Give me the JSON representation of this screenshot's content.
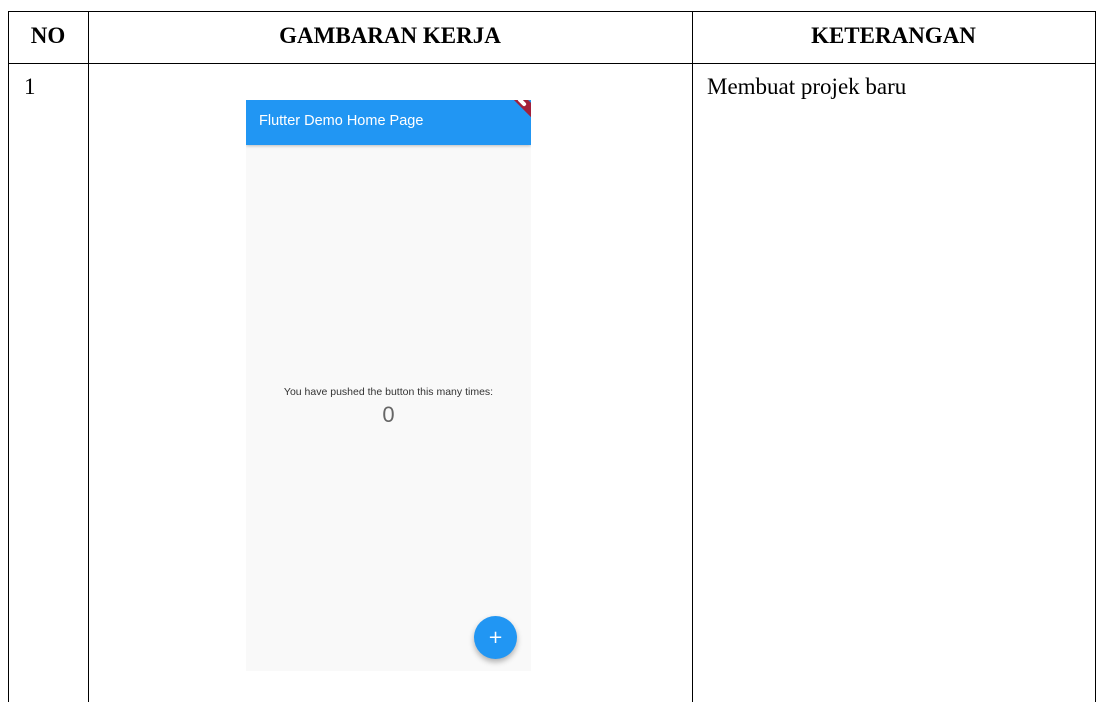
{
  "table": {
    "headers": {
      "no": "NO",
      "gambaran": "GAMBARAN KERJA",
      "keterangan": "KETERANGAN"
    },
    "rows": [
      {
        "no": "1",
        "keterangan": "Membuat projek baru"
      }
    ]
  },
  "phone": {
    "appbar_title": "Flutter Demo Home Page",
    "counter_label": "You have pushed the button this many times:",
    "counter_value": "0",
    "fab_icon": "add-icon",
    "fab_glyph": "+",
    "colors": {
      "primary": "#2196f3",
      "background": "#f9f9f9",
      "debug_banner": "#a3203a"
    }
  }
}
